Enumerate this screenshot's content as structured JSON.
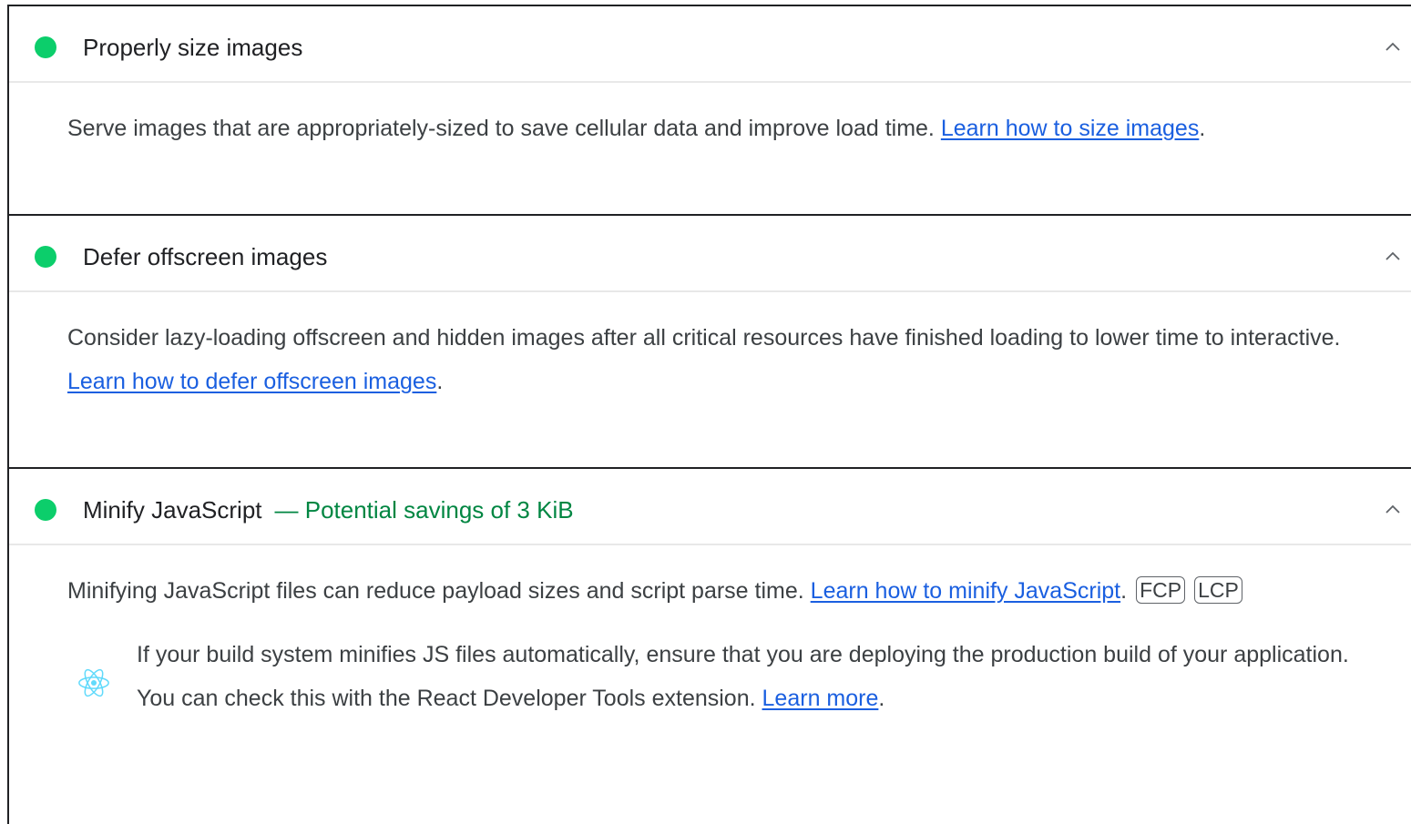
{
  "colors": {
    "pass": "#0cce6b",
    "savings": "#018642",
    "link": "#1a5fe0",
    "react": "#61dafb"
  },
  "icons": {
    "status": "pass-dot-icon",
    "expand": "chevron-up-icon",
    "stack": "react-icon"
  },
  "audits": [
    {
      "title": "Properly size images",
      "description": "Serve images that are appropriately-sized to save cellular data and improve load time.",
      "link_text": "Learn how to size images",
      "trailing": "."
    },
    {
      "title": "Defer offscreen images",
      "description": "Consider lazy-loading offscreen and hidden images after all critical resources have finished loading to lower time to interactive.",
      "link_text": "Learn how to defer offscreen images",
      "trailing": "."
    },
    {
      "title": "Minify JavaScript",
      "savings": "— Potential savings of 3 KiB",
      "description": "Minifying JavaScript files can reduce payload sizes and script parse time.",
      "link_text": "Learn how to minify JavaScript",
      "trailing": ".",
      "metrics": [
        "FCP",
        "LCP"
      ],
      "stack_note": {
        "text": "If your build system minifies JS files automatically, ensure that you are deploying the production build of your application. You can check this with the React Developer Tools extension.",
        "link_text": "Learn more",
        "trailing": "."
      }
    }
  ]
}
